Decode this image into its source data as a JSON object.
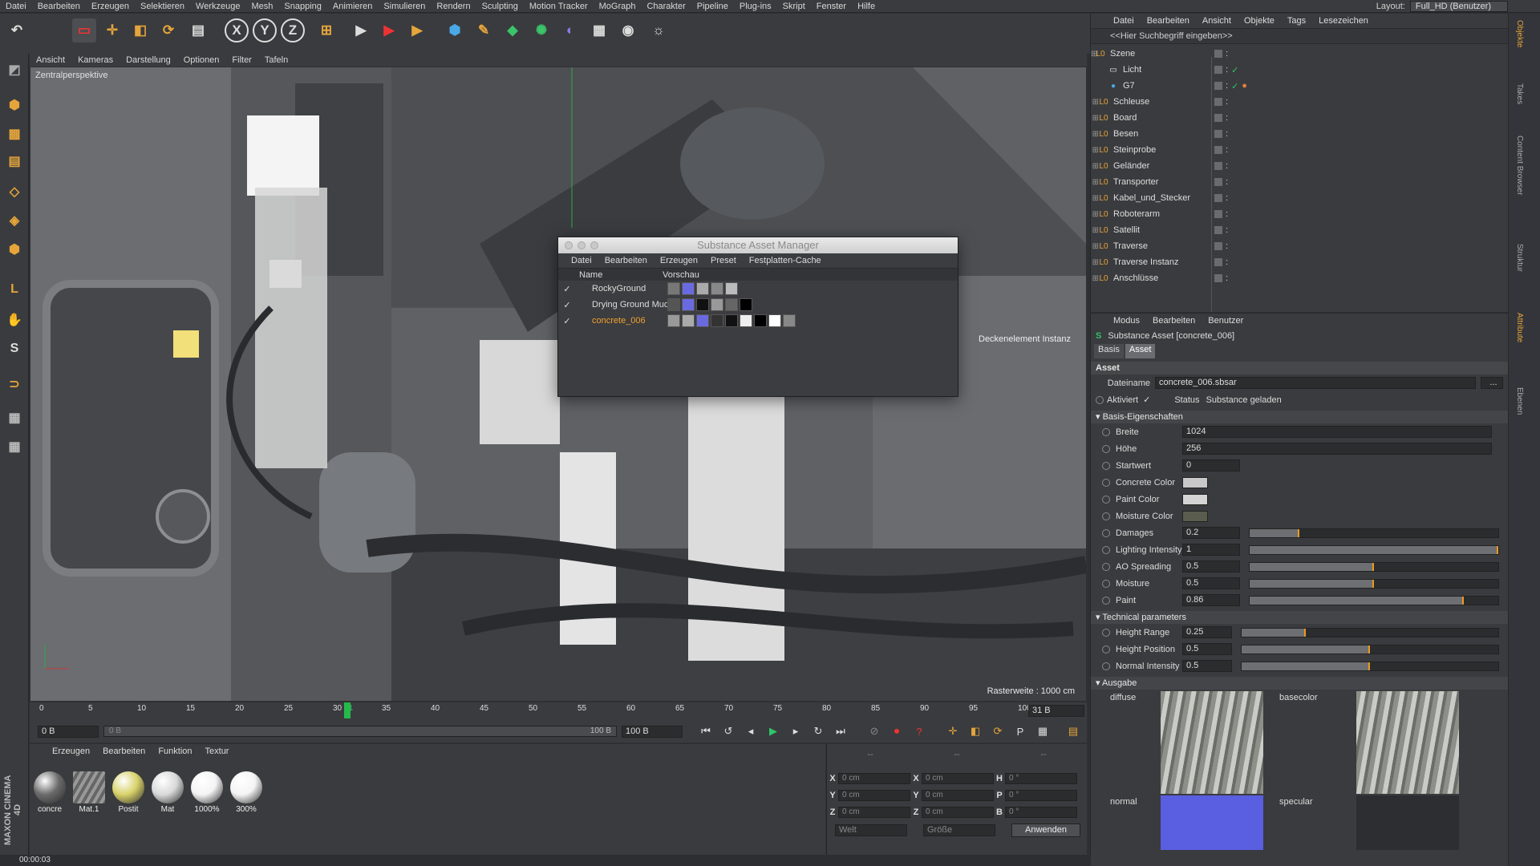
{
  "menu": [
    "Datei",
    "Bearbeiten",
    "Erzeugen",
    "Selektieren",
    "Werkzeuge",
    "Mesh",
    "Snapping",
    "Animieren",
    "Simulieren",
    "Rendern",
    "Sculpting",
    "Motion Tracker",
    "MoGraph",
    "Charakter",
    "Pipeline",
    "Plug-ins",
    "Skript",
    "Fenster",
    "Hilfe"
  ],
  "layout": {
    "label": "Layout:",
    "value": "Full_HD (Benutzer)"
  },
  "viewport": {
    "menu": [
      "Ansicht",
      "Kameras",
      "Darstellung",
      "Optionen",
      "Filter",
      "Tafeln"
    ],
    "camera_label": "Zentralperspektive",
    "raster": "Rasterweite : 1000 cm",
    "instance_label": "Deckenelement Instanz"
  },
  "substance_dialog": {
    "title": "Substance Asset Manager",
    "menu": [
      "Datei",
      "Bearbeiten",
      "Erzeugen",
      "Preset",
      "Festplatten-Cache"
    ],
    "col_name": "Name",
    "col_preview": "Vorschau",
    "rows": [
      {
        "name": "RockyGround",
        "selected": false,
        "swatches": [
          "#777",
          "#6a6ae0",
          "#aaa",
          "#888",
          "#bbb"
        ]
      },
      {
        "name": "Drying Ground Mud",
        "selected": false,
        "swatches": [
          "#555",
          "#6a6ae0",
          "#111",
          "#999",
          "#666",
          "#000"
        ]
      },
      {
        "name": "concrete_006",
        "selected": true,
        "swatches": [
          "#999",
          "#aaa",
          "#6a6ae0",
          "#333",
          "#111",
          "#eee",
          "#000",
          "#fff",
          "#888"
        ]
      }
    ]
  },
  "object_manager": {
    "menu": [
      "Datei",
      "Bearbeiten",
      "Ansicht",
      "Objekte",
      "Tags",
      "Lesezeichen"
    ],
    "search_placeholder": "<<Hier Suchbegriff eingeben>>",
    "objects": [
      "Szene",
      "Licht",
      "G7",
      "Schleuse",
      "Board",
      "Besen",
      "Steinprobe",
      "Geländer",
      "Transporter",
      "Kabel_und_Stecker",
      "Roboterarm",
      "Satellit",
      "Traverse",
      "Traverse Instanz",
      "Anschlüsse"
    ]
  },
  "right_tabs": [
    "Objekte",
    "Takes",
    "Content Browser",
    "Struktur",
    "Attribute",
    "Ebenen"
  ],
  "attributes": {
    "menu": [
      "Modus",
      "Bearbeiten",
      "Benutzer"
    ],
    "title": "Substance Asset [concrete_006]",
    "tabs": [
      "Basis",
      "Asset"
    ],
    "section": "Asset",
    "filename_label": "Dateiname",
    "filename": "concrete_006.sbsar",
    "active_label": "Aktiviert",
    "status_label": "Status",
    "status_value": "Substance geladen",
    "group_basis": "Basis-Eigenschaften",
    "breite_label": "Breite",
    "breite": "1024",
    "hoehe_label": "Höhe",
    "hoehe": "256",
    "startwert_label": "Startwert",
    "startwert": "0",
    "concrete_color_label": "Concrete Color",
    "concrete_color": "#c9c9c9",
    "paint_color_label": "Paint Color",
    "paint_color": "#d4d4d4",
    "moisture_color_label": "Moisture Color",
    "moisture_color": "#5a5c4e",
    "sliders": [
      {
        "label": "Damages",
        "value": "0.2",
        "fraction": 0.2
      },
      {
        "label": "Lighting Intensity",
        "value": "1",
        "fraction": 1.0
      },
      {
        "label": "AO Spreading",
        "value": "0.5",
        "fraction": 0.5
      },
      {
        "label": "Moisture",
        "value": "0.5",
        "fraction": 0.5
      },
      {
        "label": "Paint",
        "value": "0.86",
        "fraction": 0.86
      }
    ],
    "group_tech": "Technical parameters",
    "tech": [
      {
        "label": "Height Range",
        "value": "0.25",
        "fraction": 0.25
      },
      {
        "label": "Height Position",
        "value": "0.5",
        "fraction": 0.5
      },
      {
        "label": "Normal Intensity",
        "value": "0.5",
        "fraction": 0.5
      }
    ],
    "group_out": "Ausgabe",
    "outputs": [
      "diffuse",
      "basecolor",
      "normal",
      "specular"
    ]
  },
  "timeline": {
    "ticks": [
      "0",
      "5",
      "10",
      "15",
      "20",
      "25",
      "30",
      "31",
      "35",
      "40",
      "45",
      "50",
      "55",
      "60",
      "65",
      "70",
      "75",
      "80",
      "85",
      "90",
      "95",
      "100"
    ],
    "current": "31",
    "end_field": "31 B",
    "start": "0 B",
    "range_start": "0 B",
    "range_end": "100 B",
    "max": "100 B"
  },
  "materials": {
    "menu": [
      "Erzeugen",
      "Bearbeiten",
      "Funktion",
      "Textur"
    ],
    "items": [
      {
        "label": "concre",
        "color": "#6b6b6b"
      },
      {
        "label": "Mat.1",
        "color": "#7a7a7a"
      },
      {
        "label": "Postit",
        "color": "#d8d26a"
      },
      {
        "label": "Mat",
        "color": "#d9d9d9"
      },
      {
        "label": "1000%",
        "color": "#f4f4f4"
      },
      {
        "label": "300%",
        "color": "#f4f4f4"
      }
    ]
  },
  "coords": {
    "header": [
      "--",
      "--",
      "--"
    ],
    "rows": [
      {
        "a": "X",
        "v1": "0 cm",
        "b": "X",
        "v2": "0 cm",
        "c": "H",
        "v3": "0 °"
      },
      {
        "a": "Y",
        "v1": "0 cm",
        "b": "Y",
        "v2": "0 cm",
        "c": "P",
        "v3": "0 °"
      },
      {
        "a": "Z",
        "v1": "0 cm",
        "b": "Z",
        "v2": "0 cm",
        "c": "B",
        "v3": "0 °"
      }
    ],
    "world": "Welt",
    "size": "Größe",
    "apply": "Anwenden"
  },
  "status": "00:00:03",
  "brand": "MAXON CINEMA 4D"
}
